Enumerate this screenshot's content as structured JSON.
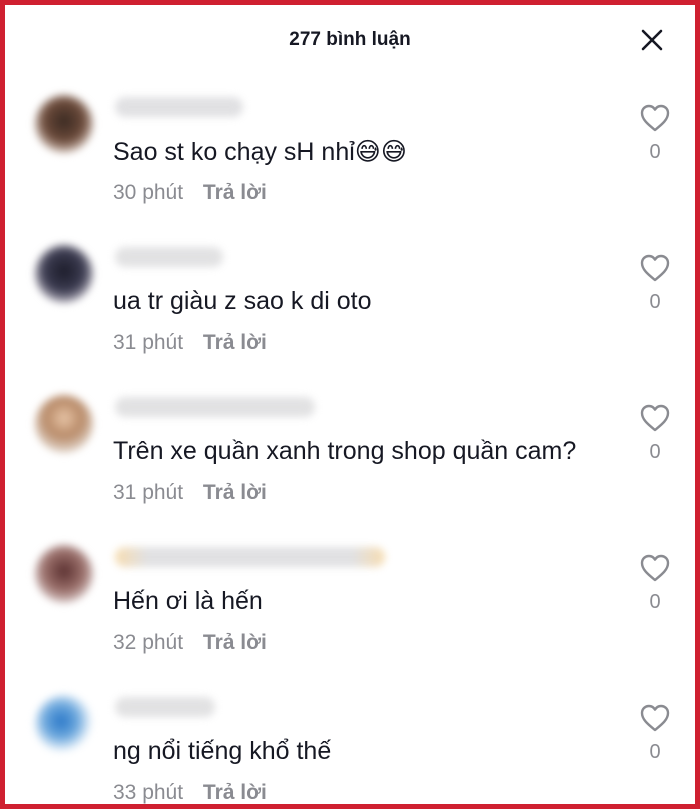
{
  "header": {
    "title": "277 bình luận"
  },
  "comments": [
    {
      "text": "Sao st ko chạy sH nhỉ😅😅",
      "time": "30 phút",
      "reply": "Trả lời",
      "likes": "0"
    },
    {
      "text": "ua tr giàu z sao k di oto",
      "time": "31 phút",
      "reply": "Trả lời",
      "likes": "0"
    },
    {
      "text": "Trên xe quần xanh trong shop quần cam?",
      "time": "31 phút",
      "reply": "Trả lời",
      "likes": "0"
    },
    {
      "text": "Hến ơi là hến",
      "time": "32 phút",
      "reply": "Trả lời",
      "likes": "0"
    },
    {
      "text": "ng nổi tiếng khổ thế",
      "time": "33 phút",
      "reply": "Trả lời",
      "likes": "0"
    }
  ],
  "colors": {
    "border": "#cf2030",
    "text": "#161823",
    "muted": "#8a8b91"
  },
  "icons": {
    "close": "close-icon",
    "like": "heart-outline-icon"
  }
}
